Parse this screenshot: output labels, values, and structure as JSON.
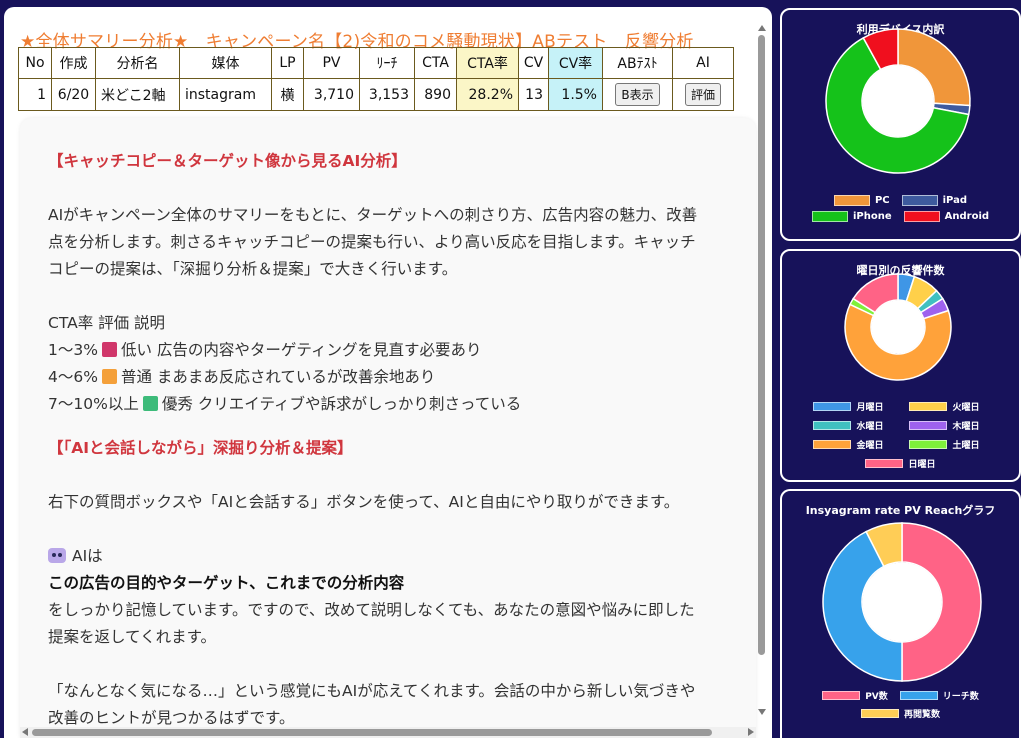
{
  "page": {
    "title": "★全体サマリー分析★　キャンペーン名【2)令和のコメ騒動現状】ABテスト　反響分析"
  },
  "table": {
    "headers": [
      "No",
      "作成",
      "分析名",
      "媒体",
      "LP",
      "PV",
      "ﾘｰﾁ",
      "CTA",
      "CTA率",
      "CV",
      "CV率",
      "ABﾃｽﾄ",
      "AI"
    ],
    "row": {
      "no": "1",
      "date": "6/20",
      "name": "米どこ2軸",
      "media": "instagram",
      "lp": "横",
      "pv": "3,710",
      "reach": "3,153",
      "cta": "890",
      "cta_rate": "28.2%",
      "cv": "13",
      "cv_rate": "1.5%",
      "ab_button": "B表示",
      "ai_button": "評価"
    }
  },
  "ai": {
    "heading1": "【キャッチコピー＆ターゲット像から見るAI分析】",
    "para1_l1": "AIがキャンペーン全体のサマリーをもとに、ターゲットへの刺さり方、広告内容の魅力、改善",
    "para1_l2": "点を分析します。刺さるキャッチコピーの提案も行い、より高い反応を目指します。キャッチ",
    "para1_l3": "コピーの提案は、「深掘り分析＆提案」で大きく行います。",
    "cta_header": "CTA率 評価 説明",
    "cta_rows": [
      {
        "range": "1〜3%",
        "color": "#d0366a",
        "text": "低い 広告の内容やターゲティングを見直す必要あり"
      },
      {
        "range": "4〜6%",
        "color": "#f4a03a",
        "text": "普通 まあまあ反応されているが改善余地あり"
      },
      {
        "range": "7〜10%以上",
        "color": "#3dbb7a",
        "text": "優秀 クリエイティブや訴求がしっかり刺さっている"
      }
    ],
    "heading2": "【「AIと会話しながら」深掘り分析＆提案】",
    "para2": "右下の質問ボックスや「AIと会話する」ボタンを使って、AIと自由にやり取りができます。",
    "ai_label": "AIは",
    "bold_line": "この広告の目的やターゲット、これまでの分析内容",
    "para3_l1": "をしっかり記憶しています。ですので、改めて説明しなくても、あなたの意図や悩みに即した",
    "para3_l2": "提案を返してくれます。",
    "para4_l1": "「なんとなく気になる…」という感覚にもAIが応えてくれます。会話の中から新しい気づきや",
    "para4_l2": "改善のヒントが見つかるはずです。"
  },
  "chart_data": [
    {
      "type": "pie",
      "title": "利用デバイス内訳",
      "categories": [
        "PC",
        "iPad",
        "iPhone",
        "Android"
      ],
      "values": [
        26,
        2,
        64,
        8
      ],
      "colors": [
        "#f0963a",
        "#3e5a9e",
        "#15c21a",
        "#f00f1e"
      ],
      "legend": "bottom"
    },
    {
      "type": "pie",
      "title": "曜日別の反響件数",
      "categories": [
        "月曜日",
        "火曜日",
        "水曜日",
        "木曜日",
        "金曜日",
        "土曜日",
        "日曜日"
      ],
      "values": [
        5,
        8,
        3,
        4,
        62,
        2,
        16
      ],
      "colors": [
        "#3f96e6",
        "#ffd04a",
        "#40c0c0",
        "#9e62ee",
        "#ffa23a",
        "#7ef03a",
        "#ff6386"
      ],
      "legend": "bottom"
    },
    {
      "type": "pie",
      "title": "Insyagram rate PV Reachグラフ",
      "categories": [
        "PV数",
        "リーチ数",
        "再閲覧数"
      ],
      "values": [
        3710,
        3153,
        557
      ],
      "colors": [
        "#ff6386",
        "#37a2eb",
        "#ffcd56"
      ],
      "legend": "bottom"
    }
  ]
}
